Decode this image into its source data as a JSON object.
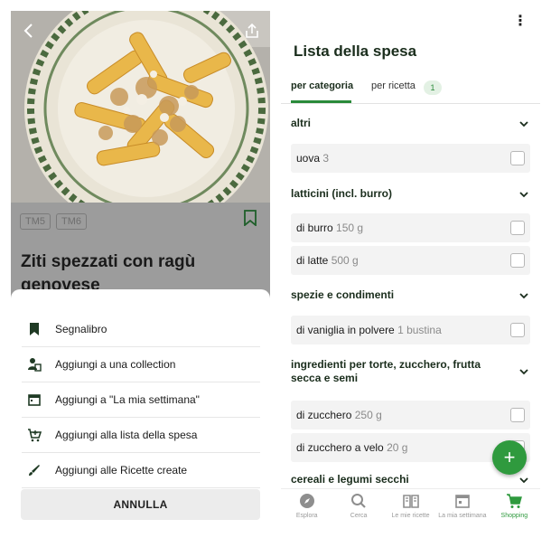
{
  "left": {
    "tags": [
      "TM5",
      "TM6"
    ],
    "recipe_title": "Ziti spezzati con ragù genovese",
    "sheet_items": [
      {
        "label": "Segnalibro",
        "icon": "bookmark-icon"
      },
      {
        "label": "Aggiungi a una collection",
        "icon": "collection-icon"
      },
      {
        "label": "Aggiungi a \"La mia settimana\"",
        "icon": "calendar-icon"
      },
      {
        "label": "Aggiungi alla lista della spesa",
        "icon": "cart-add-icon"
      },
      {
        "label": "Aggiungi alle Ricette create",
        "icon": "brush-icon"
      }
    ],
    "cancel_label": "ANNULLA"
  },
  "right": {
    "title": "Lista della spesa",
    "tabs": {
      "by_category": "per categoria",
      "by_recipe": "per ricetta",
      "recipe_count": "1"
    },
    "categories": [
      {
        "name": "altri",
        "items": [
          {
            "name": "uova",
            "qty": "3"
          }
        ]
      },
      {
        "name": "latticini (incl. burro)",
        "items": [
          {
            "name": "di burro",
            "qty": "150 g"
          },
          {
            "name": "di latte",
            "qty": "500 g"
          }
        ]
      },
      {
        "name": "spezie e condimenti",
        "items": [
          {
            "name": "di vaniglia in polvere",
            "qty": "1 bustina"
          }
        ]
      },
      {
        "name": "ingredienti per torte, zucchero, frutta secca e semi",
        "items": [
          {
            "name": "di zucchero",
            "qty": "250 g"
          },
          {
            "name": "di zucchero a velo",
            "qty": "20 g"
          }
        ]
      },
      {
        "name": "cereali e legumi secchi",
        "items": []
      }
    ],
    "fab_label": "+",
    "nav": [
      {
        "label": "Esplora",
        "icon": "compass-icon"
      },
      {
        "label": "Cerca",
        "icon": "search-icon"
      },
      {
        "label": "Le mie ricette",
        "icon": "book-icon"
      },
      {
        "label": "La mia settimana",
        "icon": "calendar-icon"
      },
      {
        "label": "Shopping",
        "icon": "cart-icon"
      }
    ]
  },
  "colors": {
    "accent": "#2f9a3e",
    "title": "#1a2d1c"
  }
}
